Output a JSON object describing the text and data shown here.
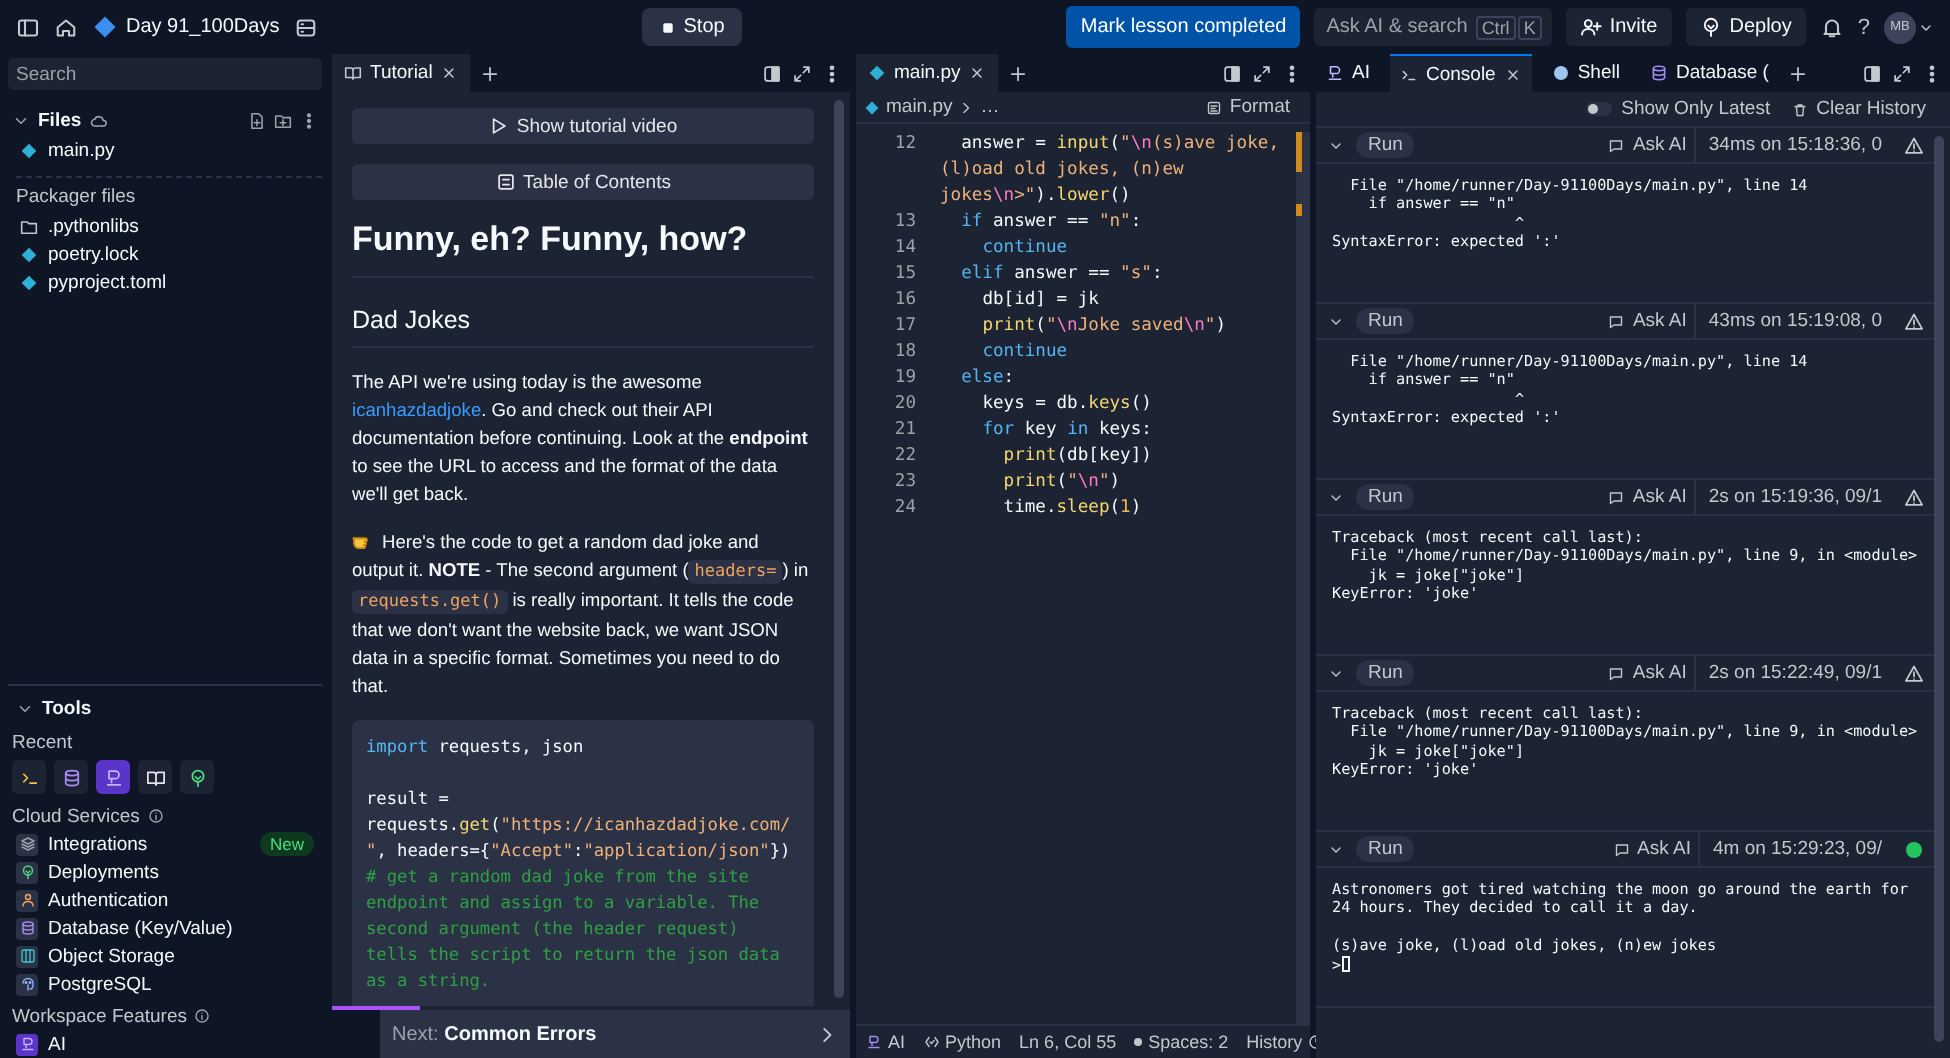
{
  "topbar": {
    "project": "Day 91_100Days",
    "stop": "Stop",
    "mark_lesson": "Mark lesson completed",
    "ask_ai": "Ask AI & search",
    "keys": [
      "Ctrl",
      "K"
    ],
    "invite": "Invite",
    "deploy": "Deploy",
    "help": "?",
    "avatar": "MB"
  },
  "sidebar": {
    "search": {
      "placeholder": "Search"
    },
    "files_title": "Files",
    "files": [
      {
        "name": "main.py",
        "kind": "python"
      }
    ],
    "packager_title": "Packager files",
    "packager_files": [
      {
        "name": ".pythonlibs",
        "kind": "folder"
      },
      {
        "name": "poetry.lock",
        "kind": "python"
      },
      {
        "name": "pyproject.toml",
        "kind": "python"
      }
    ],
    "tools_title": "Tools",
    "recent_label": "Recent",
    "recent_tools": [
      {
        "kind": "terminal",
        "selected": false
      },
      {
        "kind": "database",
        "selected": false
      },
      {
        "kind": "ai",
        "selected": true
      },
      {
        "kind": "book",
        "selected": false
      },
      {
        "kind": "deploy",
        "selected": false
      }
    ],
    "cloud_title": "Cloud Services",
    "cloud_services": [
      {
        "label": "Integrations",
        "kind": "integrations",
        "badge": "New"
      },
      {
        "label": "Deployments",
        "kind": "deploy"
      },
      {
        "label": "Authentication",
        "kind": "auth"
      },
      {
        "label": "Database (Key/Value)",
        "kind": "database"
      },
      {
        "label": "Object Storage",
        "kind": "storage"
      },
      {
        "label": "PostgreSQL",
        "kind": "postgres"
      }
    ],
    "workspace_title": "Workspace Features",
    "workspace_features": [
      {
        "label": "AI",
        "kind": "ai"
      }
    ]
  },
  "tutorial": {
    "tabs": [
      {
        "label": "Tutorial",
        "selected": true
      }
    ],
    "video_button": "Show tutorial video",
    "toc_button": "Table of Contents",
    "title": "Funny, eh? Funny, how?",
    "heading": "Dad Jokes",
    "paragraphs": [
      {
        "kind": "text",
        "parts": [
          {
            "kind": "text",
            "text": "The API we're using today is the awesome "
          },
          {
            "kind": "link",
            "text": "icanhazdadjoke"
          },
          {
            "kind": "text",
            "text": ". Go and check out their API documentation before continuing. Look at the **endpoint** to see the URL to access and the format of the data we'll get back."
          }
        ]
      },
      {
        "kind": "tip",
        "parts": [
          {
            "kind": "text",
            "text": "Here's the code to get a random dad joke and output it. **NOTE** - The second argument ("
          },
          {
            "kind": "code",
            "text": "headers="
          },
          {
            "kind": "text",
            "text": ") in "
          },
          {
            "kind": "code",
            "text": "requests.get()"
          },
          {
            "kind": "text",
            "text": " is really important. It tells the code that we don't want the website back, we want JSON data in a specific format. Sometimes you need to do that."
          }
        ]
      }
    ],
    "code": [
      {
        "tokens": [
          {
            "kind": "kw",
            "text": "import"
          },
          {
            "kind": "plain",
            "text": " requests, json"
          }
        ]
      },
      {
        "tokens": [
          {
            "kind": "plain",
            "text": "result = requests."
          },
          {
            "kind": "fn",
            "text": "get"
          },
          {
            "kind": "plain",
            "text": "("
          },
          {
            "kind": "str",
            "text": "\"https://icanhazdadjoke.com/\""
          },
          {
            "kind": "plain",
            "text": ", headers={"
          },
          {
            "kind": "str",
            "text": "\"Accept\""
          },
          {
            "kind": "plain",
            "text": ":"
          },
          {
            "kind": "str",
            "text": "\"application/json\""
          },
          {
            "kind": "plain",
            "text": "}) "
          },
          {
            "kind": "comment",
            "text": "# get a random dad joke from the site endpoint and assign to a variable. The second argument (the header request) tells the script to return the json data as a string."
          }
        ]
      }
    ],
    "progress": {
      "level": 0.17
    },
    "next": "Next: **Common Errors**"
  },
  "editor": {
    "tabs": [
      {
        "label": "main.py",
        "selected": true
      }
    ],
    "breadcrumb": [
      "main.py",
      "…"
    ],
    "format": "Format",
    "lines": [
      {
        "n": "12",
        "tokens": [
          {
            "kind": "plain",
            "text": "  answer = "
          },
          {
            "kind": "fn",
            "text": "input"
          },
          {
            "kind": "plain",
            "text": "("
          },
          {
            "kind": "str",
            "text": "\""
          },
          {
            "kind": "esc",
            "text": "\\n"
          },
          {
            "kind": "str",
            "text": "(s)ave joke, (l)oad old jokes, (n)ew jokes"
          },
          {
            "kind": "esc",
            "text": "\\n"
          },
          {
            "kind": "str",
            "text": ">\""
          },
          {
            "kind": "plain",
            "text": ")."
          },
          {
            "kind": "fn",
            "text": "lower"
          },
          {
            "kind": "plain",
            "text": "()"
          }
        ]
      },
      {
        "n": "13",
        "tokens": [
          {
            "kind": "kw",
            "text": "  if"
          },
          {
            "kind": "plain",
            "text": " answer == "
          },
          {
            "kind": "str",
            "text": "\"n\""
          },
          {
            "kind": "plain",
            "text": ":"
          }
        ]
      },
      {
        "n": "14",
        "tokens": [
          {
            "kind": "kw",
            "text": "    continue"
          }
        ]
      },
      {
        "n": "15",
        "tokens": [
          {
            "kind": "kw",
            "text": "  elif"
          },
          {
            "kind": "plain",
            "text": " answer == "
          },
          {
            "kind": "str",
            "text": "\"s\""
          },
          {
            "kind": "plain",
            "text": ":"
          }
        ]
      },
      {
        "n": "16",
        "tokens": [
          {
            "kind": "plain",
            "text": "    db[id] = jk"
          }
        ]
      },
      {
        "n": "17",
        "tokens": [
          {
            "kind": "fn",
            "text": "    print"
          },
          {
            "kind": "plain",
            "text": "("
          },
          {
            "kind": "str",
            "text": "\""
          },
          {
            "kind": "esc",
            "text": "\\n"
          },
          {
            "kind": "str",
            "text": "Joke saved"
          },
          {
            "kind": "esc",
            "text": "\\n"
          },
          {
            "kind": "str",
            "text": "\""
          },
          {
            "kind": "plain",
            "text": ")"
          }
        ]
      },
      {
        "n": "18",
        "tokens": [
          {
            "kind": "kw",
            "text": "    continue"
          }
        ]
      },
      {
        "n": "19",
        "tokens": [
          {
            "kind": "kw",
            "text": "  else"
          },
          {
            "kind": "plain",
            "text": ":"
          }
        ]
      },
      {
        "n": "20",
        "tokens": [
          {
            "kind": "plain",
            "text": "    keys = db."
          },
          {
            "kind": "fn",
            "text": "keys"
          },
          {
            "kind": "plain",
            "text": "()"
          }
        ]
      },
      {
        "n": "21",
        "tokens": [
          {
            "kind": "kw",
            "text": "    for"
          },
          {
            "kind": "plain",
            "text": " key "
          },
          {
            "kind": "kw",
            "text": "in"
          },
          {
            "kind": "plain",
            "text": " keys:"
          }
        ]
      },
      {
        "n": "22",
        "tokens": [
          {
            "kind": "fn",
            "text": "      print"
          },
          {
            "kind": "plain",
            "text": "(db[key])"
          }
        ]
      },
      {
        "n": "23",
        "tokens": [
          {
            "kind": "fn",
            "text": "      print"
          },
          {
            "kind": "plain",
            "text": "("
          },
          {
            "kind": "str",
            "text": "\""
          },
          {
            "kind": "esc",
            "text": "\\n"
          },
          {
            "kind": "str",
            "text": "\""
          },
          {
            "kind": "plain",
            "text": ")"
          }
        ]
      },
      {
        "n": "24",
        "tokens": [
          {
            "kind": "plain",
            "text": "      time."
          },
          {
            "kind": "fn",
            "text": "sleep"
          },
          {
            "kind": "plain",
            "text": "("
          },
          {
            "kind": "num",
            "text": "1"
          },
          {
            "kind": "plain",
            "text": ")"
          }
        ]
      }
    ],
    "status": {
      "ai": "AI",
      "language": "Python",
      "position": "Ln 6, Col 55",
      "spaces": "Spaces: 2",
      "history": "History"
    }
  },
  "console": {
    "tabs": [
      {
        "label": "AI",
        "kind": "ai",
        "selected": false
      },
      {
        "label": "Console",
        "kind": "console",
        "selected": true
      },
      {
        "label": "Shell",
        "kind": "shell",
        "selected": false
      },
      {
        "label": "Database (",
        "kind": "database",
        "selected": false
      }
    ],
    "show_only_latest": {
      "label": "Show Only Latest",
      "on": false
    },
    "clear_history": "Clear History",
    "runs": [
      {
        "label": "Run",
        "ask_ai": "Ask AI",
        "time": "34ms on 15:18:36, 0",
        "kind": "error",
        "output": "  File \"/home/runner/Day-91100Days/main.py\", line 14\n    if answer == \"n\"\n                    ^\nSyntaxError: expected ':'"
      },
      {
        "label": "Run",
        "ask_ai": "Ask AI",
        "time": "43ms on 15:19:08, 0",
        "kind": "error",
        "output": "  File \"/home/runner/Day-91100Days/main.py\", line 14\n    if answer == \"n\"\n                    ^\nSyntaxError: expected ':'"
      },
      {
        "label": "Run",
        "ask_ai": "Ask AI",
        "time": "2s on 15:19:36, 09/1",
        "kind": "error",
        "output": "Traceback (most recent call last):\n  File \"/home/runner/Day-91100Days/main.py\", line 9, in <module>\n    jk = joke[\"joke\"]\nKeyError: 'joke'"
      },
      {
        "label": "Run",
        "ask_ai": "Ask AI",
        "time": "2s on 15:22:49, 09/1",
        "kind": "error",
        "output": "Traceback (most recent call last):\n  File \"/home/runner/Day-91100Days/main.py\", line 9, in <module>\n    jk = joke[\"joke\"]\nKeyError: 'joke'"
      },
      {
        "label": "Run",
        "ask_ai": "Ask AI",
        "time": "4m on 15:29:23, 09/",
        "kind": "running",
        "output": "Astronomers got tired watching the moon go around the earth for 24 hours. They decided to call it a day.\n\n(s)ave joke, (l)oad old jokes, (n)ew jokes\n>"
      }
    ]
  }
}
